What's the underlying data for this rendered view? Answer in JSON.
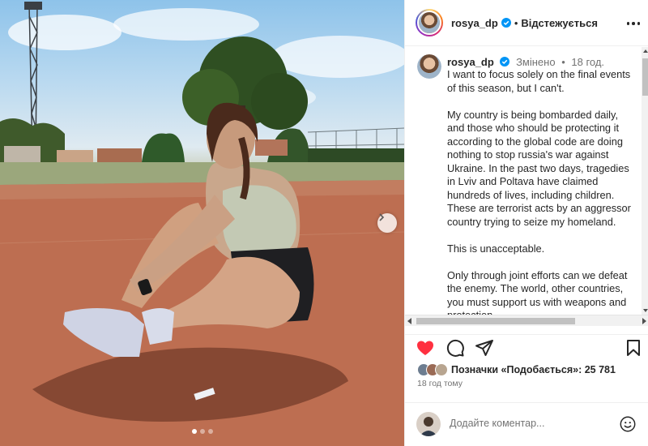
{
  "post": {
    "username": "rosya_dp",
    "follow_dot": "•",
    "follow_label": "Відстежується",
    "more_icon": "more-horizontal-icon",
    "verified_color": "#0095f6"
  },
  "caption": {
    "username": "rosya_dp",
    "edited": "Змінено",
    "separator": "•",
    "time": "18 год.",
    "text": "I want to focus solely on the final events of this season, but I can't.\n\nMy country is being bombarded daily, and those who should be protecting it according to the global code are doing nothing to stop russia's war against Ukraine. In the past two days, tragedies in Lviv and Poltava have claimed hundreds of lives, including children. These are terrorist acts by an aggressor country trying to seize my homeland.\n\nThis is unacceptable.\n\nOnly through joint efforts can we defeat the enemy. The world, other countries, you must support us with weapons and protection."
  },
  "actions": {
    "like_icon": "heart-filled-icon",
    "like_color": "#ff3040",
    "comment_icon": "comment-icon",
    "share_icon": "send-icon",
    "save_icon": "bookmark-icon"
  },
  "likes": {
    "label": "Позначки «Подобається»: 25 781"
  },
  "post_time": "18 год тому",
  "comment_box": {
    "placeholder": "Додайте коментар...",
    "emoji_icon": "emoji-icon"
  },
  "carousel": {
    "slides": 3,
    "active": 1
  }
}
